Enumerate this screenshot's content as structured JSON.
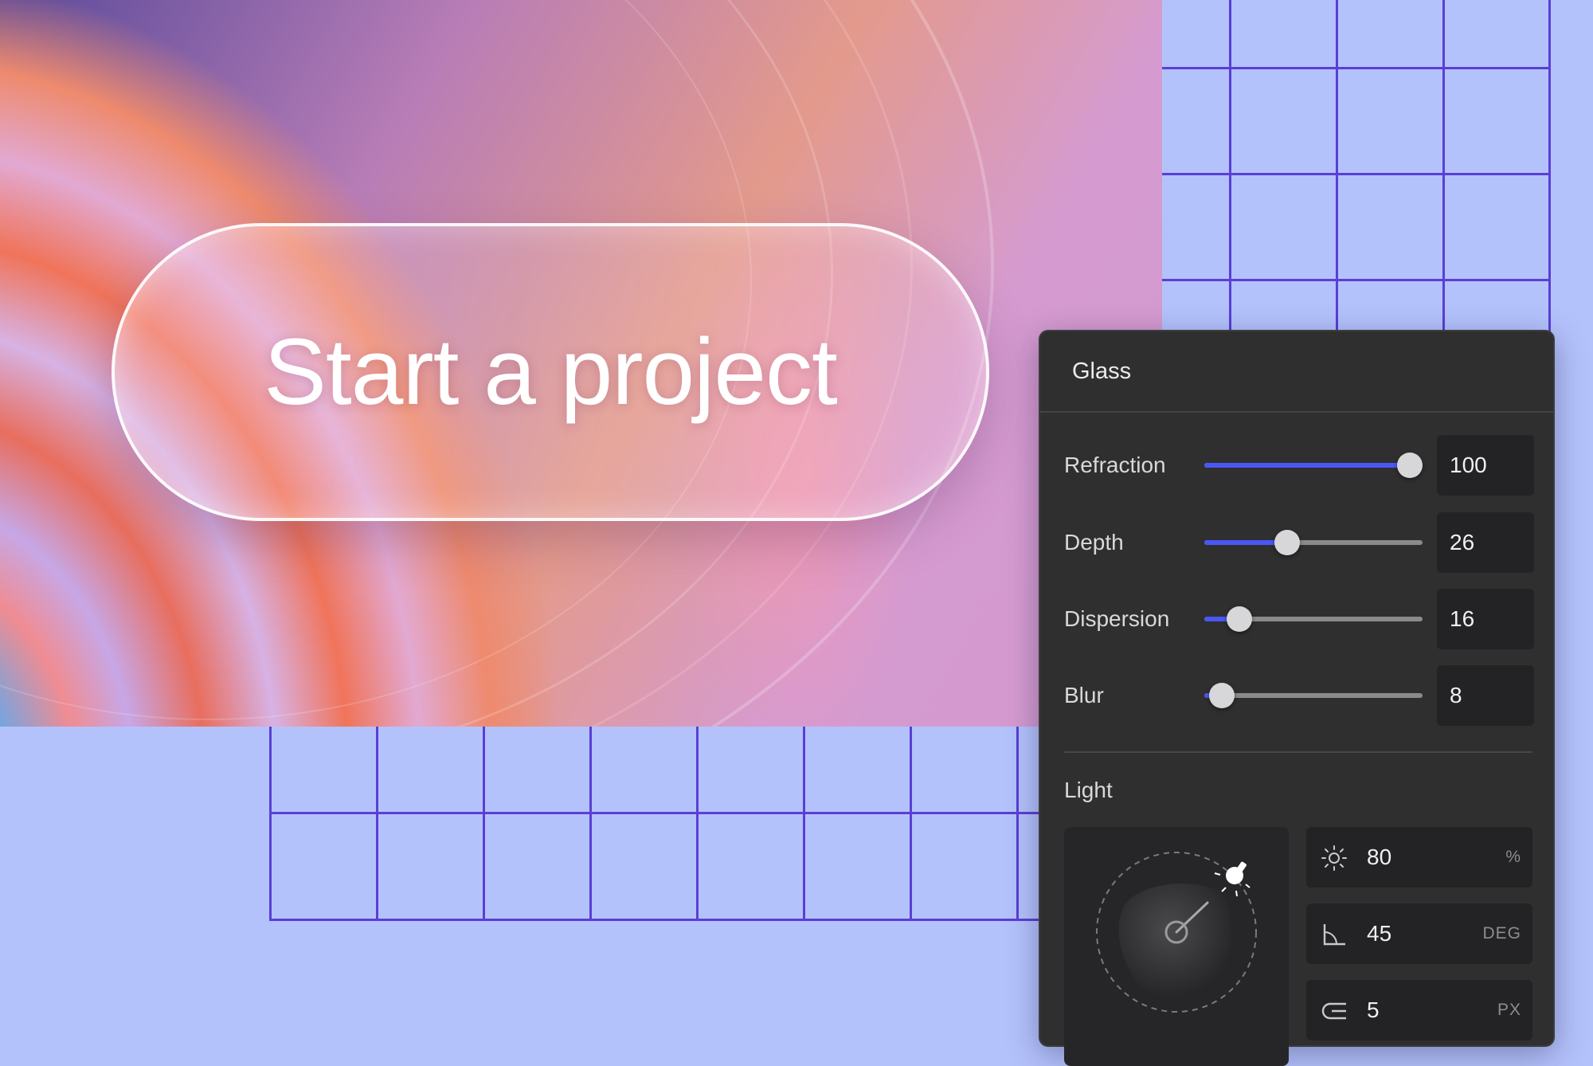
{
  "hero": {
    "cta_label": "Start a project"
  },
  "panel": {
    "title": "Glass",
    "sliders": [
      {
        "label": "Refraction",
        "value": "100",
        "level": 1.0
      },
      {
        "label": "Depth",
        "value": "26",
        "level": 0.38
      },
      {
        "label": "Dispersion",
        "value": "16",
        "level": 0.16
      },
      {
        "label": "Blur",
        "value": "8",
        "level": 0.08
      }
    ],
    "light": {
      "section_label": "Light",
      "intensity": {
        "value": "80",
        "unit": "%",
        "icon": "sun-icon"
      },
      "angle": {
        "value": "45",
        "unit": "DEG",
        "icon": "angle-icon"
      },
      "distance": {
        "value": "5",
        "unit": "PX",
        "icon": "distance-icon"
      }
    }
  },
  "colors": {
    "accent": "#4a57f5",
    "panel_bg": "#2f2f30",
    "grid_line": "#5a3fd4",
    "background": "#b4c2fc"
  }
}
